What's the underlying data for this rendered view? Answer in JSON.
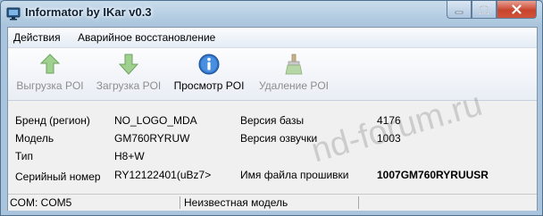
{
  "window": {
    "title": "Informator by IKar v0.3"
  },
  "menu": {
    "items": [
      "Действия",
      "Аварийное восстановление"
    ]
  },
  "toolbar": {
    "buttons": [
      {
        "label": "Выгрузка POI",
        "icon": "upload-arrow-icon",
        "enabled": false
      },
      {
        "label": "Загрузка POI",
        "icon": "download-arrow-icon",
        "enabled": false
      },
      {
        "label": "Просмотр POI",
        "icon": "info-icon",
        "enabled": true
      },
      {
        "label": "Удаление POI",
        "icon": "broom-icon",
        "enabled": false
      }
    ]
  },
  "info": {
    "brand_label": "Бренд (регион)",
    "brand_value": "NO_LOGO_MDA",
    "model_label": "Модель",
    "model_value": "GM760RYRUW",
    "type_label": "Тип",
    "type_value": "H8+W",
    "serial_label": "Серийный номер",
    "serial_value": "RY12122401(uBz7>",
    "db_version_label": "Версия базы",
    "db_version_value": "4176",
    "voice_version_label": "Версия озвучки",
    "voice_version_value": "1003",
    "firmware_file_label": "Имя файла прошивки",
    "firmware_file_value": "1007GM760RYRUUSR"
  },
  "watermark": "nd-forum.ru",
  "status": {
    "port": "COM: COM5",
    "model": "Неизвестная модель"
  },
  "colors": {
    "titlebar": "#a9c4dc",
    "close_button": "#c8452d",
    "disabled_text": "#8d8d8d",
    "info_icon": "#2f73c8"
  }
}
